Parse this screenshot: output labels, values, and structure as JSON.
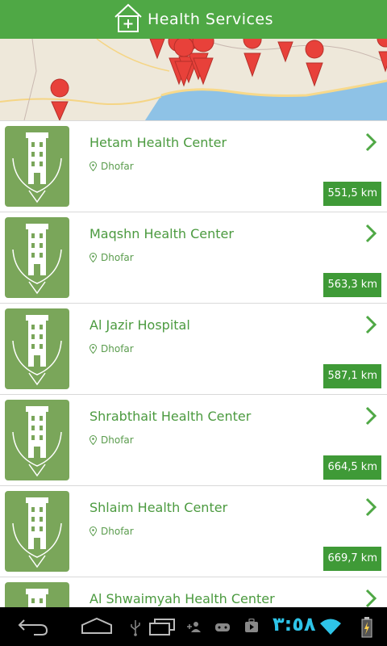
{
  "header": {
    "title": "Health Services",
    "icon": "house-plus-icon"
  },
  "map": {
    "marker_color": "#e8413a"
  },
  "facilities": [
    {
      "name": "Hetam Health Center",
      "region": "Dhofar",
      "distance": "551,5 km"
    },
    {
      "name": "Maqshn Health Center",
      "region": "Dhofar",
      "distance": "563,3 km"
    },
    {
      "name": "Al Jazir Hospital",
      "region": "Dhofar",
      "distance": "587,1 km"
    },
    {
      "name": "Shrabthait Health Center",
      "region": "Dhofar",
      "distance": "664,5 km"
    },
    {
      "name": "Shlaim Health Center",
      "region": "Dhofar",
      "distance": "669,7 km"
    },
    {
      "name": "Al Shwaimyah Health Center",
      "region": "",
      "distance": ""
    }
  ],
  "system_bar": {
    "clock": "٣:٥٨"
  },
  "colors": {
    "brand_green": "#4fa845",
    "distance_badge": "#3f9a37",
    "clock_blue": "#2ec4e8"
  }
}
